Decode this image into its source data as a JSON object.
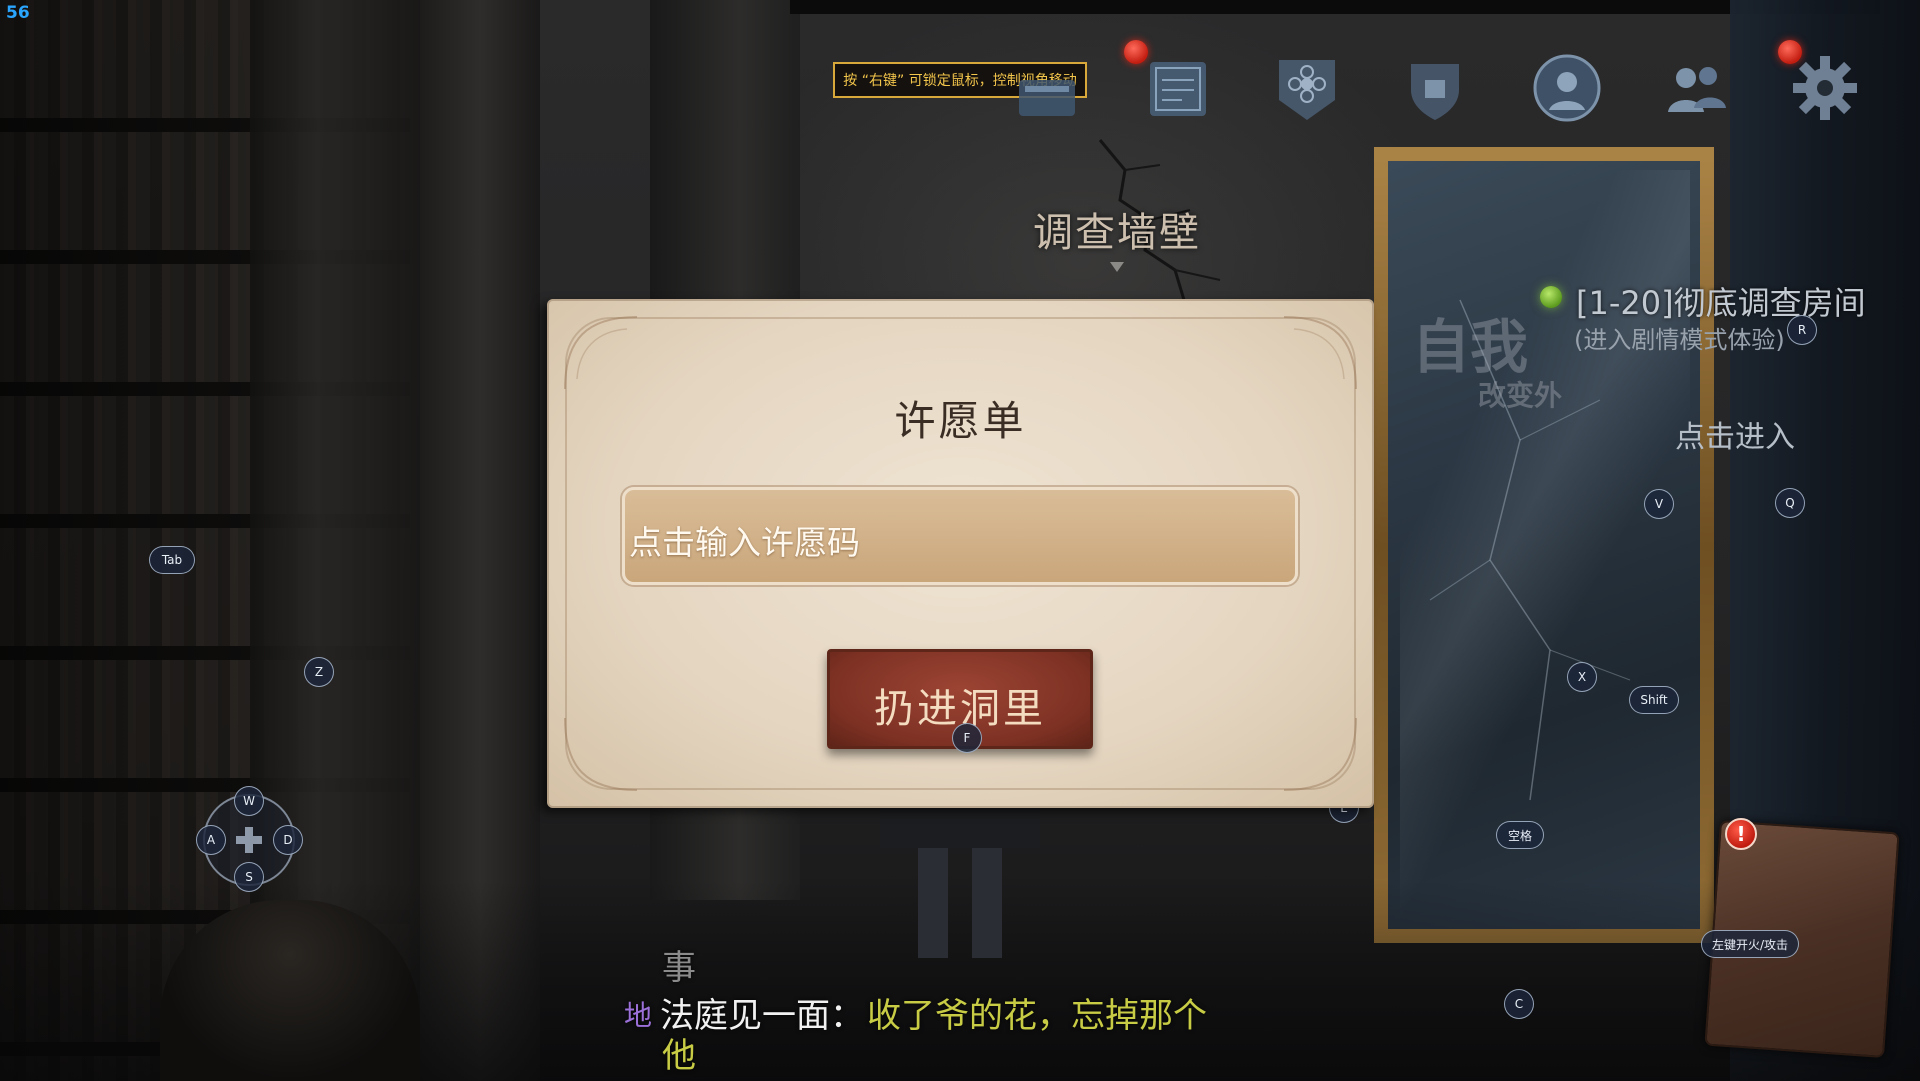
{
  "fps": "56",
  "hint": {
    "text": "按 “右键” 可锁定鼠标，控制视角移动"
  },
  "top_icons": [
    {
      "icon": "card-icon"
    },
    {
      "icon": "notebook-icon",
      "badge": "red-dot"
    },
    {
      "icon": "flower-emblem-icon"
    },
    {
      "icon": "shield-icon"
    },
    {
      "icon": "portrait-icon"
    },
    {
      "icon": "friends-icon"
    },
    {
      "icon": "gear-icon",
      "badge": "red-dot"
    }
  ],
  "interaction_prompt": "调查墙壁",
  "modal": {
    "title": "许愿单",
    "input_placeholder": "点击输入许愿码",
    "submit_label": "扔进洞里",
    "submit_key": "F"
  },
  "quest": {
    "title": "[1-20]彻底调查房间",
    "subtitle": "(进入剧情模式体验)",
    "key": "R"
  },
  "mirror": {
    "big_text": "自我",
    "sub_text": "改变外",
    "enter_label": "点击进入"
  },
  "keys": {
    "tab": "Tab",
    "z": "Z",
    "v": "V",
    "q": "Q",
    "x": "X",
    "shift": "Shift",
    "e": "E",
    "space": "空格",
    "attack": "左键开火/攻击",
    "c": "C"
  },
  "dpad": {
    "up": "W",
    "left": "A",
    "right": "D",
    "down": "S"
  },
  "book_alert": "!",
  "subtitles": {
    "line1": "事",
    "speaker": "地",
    "prefix": "法庭见一面：",
    "highlight": "收了爷的花，忘掉那个",
    "line3": "他"
  },
  "colors": {
    "fps": "#2aa6ff",
    "hint_border": "#d9a83a",
    "parchment": "#e4d5c0",
    "button_red": "#7d3123",
    "highlight_text": "#c8cc45",
    "speaker_text": "#9b70d8",
    "alert_red": "#c01c10",
    "quest_green": "#5c9b1e"
  }
}
